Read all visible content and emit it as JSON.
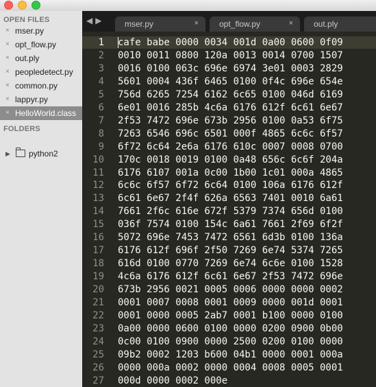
{
  "window": {
    "controls": [
      "close",
      "minimize",
      "zoom"
    ]
  },
  "sidebar": {
    "open_files_header": "OPEN FILES",
    "open_files": [
      {
        "name": "mser.py",
        "active": false
      },
      {
        "name": "opt_flow.py",
        "active": false
      },
      {
        "name": "out.ply",
        "active": false
      },
      {
        "name": "peopledetect.py",
        "active": false
      },
      {
        "name": "common.py",
        "active": false
      },
      {
        "name": "lappyr.py",
        "active": false
      },
      {
        "name": "HelloWorld.class",
        "active": true
      }
    ],
    "close_glyph": "×",
    "folders_header": "FOLDERS",
    "folders": [
      {
        "name": "python2",
        "icon": "folder-icon",
        "expanded": false
      }
    ]
  },
  "tabs": {
    "nav_left": "◀",
    "nav_right": "▶",
    "items": [
      {
        "label": "mser.py",
        "close": "×"
      },
      {
        "label": "opt_flow.py",
        "close": "×"
      },
      {
        "label": "out.ply",
        "close": ""
      }
    ]
  },
  "editor": {
    "current_line": 1,
    "lines": [
      "cafe babe 0000 0034 001d 0a00 0600 0f09",
      "0010 0011 0800 120a 0013 0014 0700 1507",
      "0016 0100 063c 696e 6974 3e01 0003 2829",
      "5601 0004 436f 6465 0100 0f4c 696e 654e",
      "756d 6265 7254 6162 6c65 0100 046d 6169",
      "6e01 0016 285b 4c6a 6176 612f 6c61 6e67",
      "2f53 7472 696e 673b 2956 0100 0a53 6f75",
      "7263 6546 696c 6501 000f 4865 6c6c 6f57",
      "6f72 6c64 2e6a 6176 610c 0007 0008 0700",
      "170c 0018 0019 0100 0a48 656c 6c6f 204a",
      "6176 6107 001a 0c00 1b00 1c01 000a 4865",
      "6c6c 6f57 6f72 6c64 0100 106a 6176 612f",
      "6c61 6e67 2f4f 626a 6563 7401 0010 6a61",
      "7661 2f6c 616e 672f 5379 7374 656d 0100",
      "036f 7574 0100 154c 6a61 7661 2f69 6f2f",
      "5072 696e 7453 7472 6561 6d3b 0100 136a",
      "6176 612f 696f 2f50 7269 6e74 5374 7265",
      "616d 0100 0770 7269 6e74 6c6e 0100 1528",
      "4c6a 6176 612f 6c61 6e67 2f53 7472 696e",
      "673b 2956 0021 0005 0006 0000 0000 0002",
      "0001 0007 0008 0001 0009 0000 001d 0001",
      "0001 0000 0005 2ab7 0001 b100 0000 0100",
      "0a00 0000 0600 0100 0000 0200 0900 0b00",
      "0c00 0100 0900 0000 2500 0200 0100 0000",
      "09b2 0002 1203 b600 04b1 0000 0001 000a",
      "0000 000a 0002 0000 0004 0008 0005 0001",
      "000d 0000 0002 000e"
    ]
  }
}
